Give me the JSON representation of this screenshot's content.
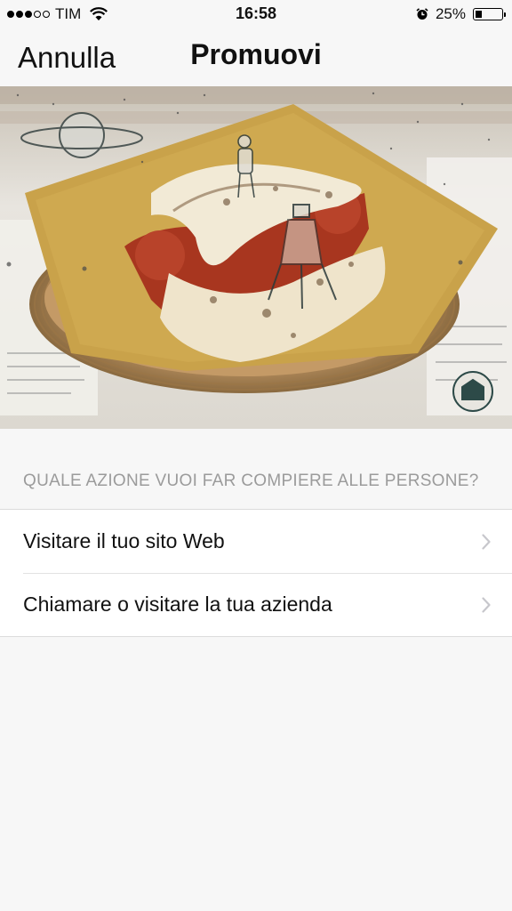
{
  "status_bar": {
    "carrier": "TIM",
    "time": "16:58",
    "battery": "25%",
    "battery_level": 0.25,
    "signal_bars_filled": 3,
    "signal_bars_total": 5,
    "icons": [
      "signal-dots-icon",
      "wifi-icon",
      "alarm-icon",
      "battery-icon"
    ]
  },
  "nav": {
    "cancel_label": "Annulla",
    "title": "Promuovi"
  },
  "hero": {
    "description_icon": "food-photo-image"
  },
  "section": {
    "header": "QUALE AZIONE VUOI FAR COMPIERE ALLE PERSONE?"
  },
  "options": [
    {
      "label": "Visitare il tuo sito Web",
      "icon": "chevron-right-icon"
    },
    {
      "label": "Chiamare o visitare la tua azienda",
      "icon": "chevron-right-icon"
    }
  ],
  "colors": {
    "background": "#f7f7f7",
    "section_header": "#9b9b9b",
    "chevron": "#c7c7cc"
  }
}
